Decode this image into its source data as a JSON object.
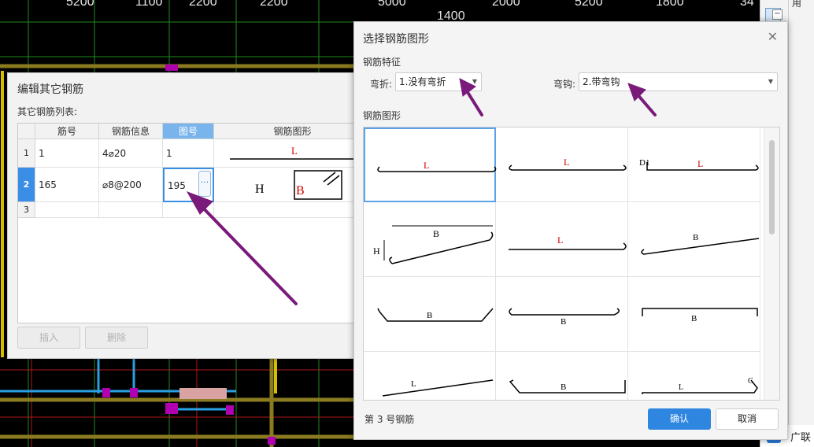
{
  "ruler": [
    "5200",
    "1100",
    "2200",
    "2200",
    "5000",
    "1400",
    "2000",
    "5200",
    "1800",
    "34"
  ],
  "right_panel": {
    "brand_text": "广联",
    "top_text": "用"
  },
  "edit_dialog": {
    "title": "编辑其它钢筋",
    "list_label": "其它钢筋列表:",
    "columns": [
      "筋号",
      "钢筋信息",
      "图号",
      "钢筋图形"
    ],
    "rows": [
      {
        "num": "1",
        "bar_no": "1",
        "info": "4⌀20",
        "shape_no": "1",
        "fig_label": "L"
      },
      {
        "num": "2",
        "bar_no": "165",
        "info": "⌀8@200",
        "shape_no": "195",
        "fig_h": "H",
        "fig_b": "B"
      },
      {
        "num": "3",
        "bar_no": "",
        "info": "",
        "shape_no": ""
      }
    ],
    "ellipsis": "···",
    "insert_btn": "插入",
    "delete_btn": "删除"
  },
  "shape_dialog": {
    "title": "选择钢筋图形",
    "close_icon": "close-icon",
    "feature_label": "钢筋特征",
    "bend_label": "弯折:",
    "bend_value": "1.没有弯折",
    "hook_label": "弯钩:",
    "hook_value": "2.带弯钩",
    "shape_label": "钢筋图形",
    "tiles": [
      {
        "labels": [
          "L"
        ]
      },
      {
        "labels": [
          "L"
        ]
      },
      {
        "labels": [
          "D1",
          "L"
        ]
      },
      {
        "labels": [
          "B",
          "H"
        ]
      },
      {
        "labels": [
          "L"
        ]
      },
      {
        "labels": [
          "B"
        ]
      },
      {
        "labels": [
          "B"
        ]
      },
      {
        "labels": [
          "B"
        ]
      },
      {
        "labels": [
          "B"
        ]
      },
      {
        "labels": [
          "L"
        ]
      },
      {
        "labels": [
          "B"
        ]
      },
      {
        "labels": [
          "L",
          "C"
        ]
      }
    ],
    "selected_tile": 1,
    "footer": "第 3 号钢筋",
    "ok": "确认",
    "cancel": "取消"
  },
  "colors": {
    "accent": "#2e86e0",
    "arrow": "#7a1a7a",
    "label_red": "#d40000"
  }
}
